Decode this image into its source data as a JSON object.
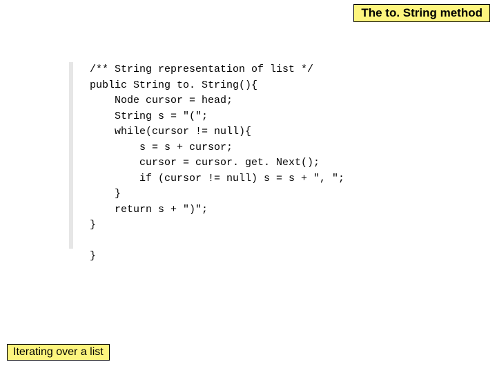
{
  "title": "The to. String method",
  "code": "/** String representation of list */\npublic String to. String(){\n    Node cursor = head;\n    String s = \"(\";\n    while(cursor != null){\n        s = s + cursor;\n        cursor = cursor. get. Next();\n        if (cursor != null) s = s + \", \";\n    }\n    return s + \")\";\n}\n\n}",
  "footer": "Iterating over a list"
}
